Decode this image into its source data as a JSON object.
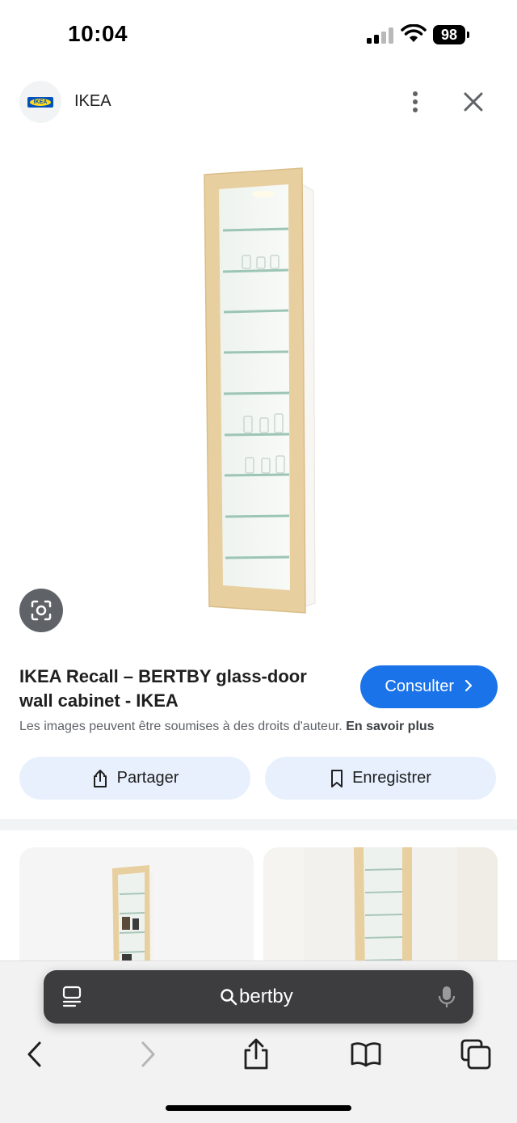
{
  "status": {
    "time": "10:04",
    "battery": "98"
  },
  "header": {
    "site_name": "IKEA",
    "logo_text": "IKEA"
  },
  "result": {
    "title": "IKEA Recall – BERTBY glass-door wall cabinet - IKEA",
    "visit_label": "Consulter",
    "copyright_text": "Les images peuvent être soumises à des droits d'auteur.",
    "learn_more": "En savoir plus",
    "share_label": "Partager",
    "save_label": "Enregistrer"
  },
  "browser": {
    "address_text": "bertby"
  },
  "colors": {
    "accent": "#1a73e8",
    "pill_bg": "#e8f0fe",
    "cabinet_wood": "#e8cfa0"
  },
  "icons": [
    "lens-icon",
    "more-vert-icon",
    "close-icon",
    "share-icon",
    "bookmark-icon",
    "tabs-icon",
    "search-icon",
    "mic-icon",
    "back-icon",
    "forward-icon",
    "bookmarks-icon",
    "tab-overview-icon"
  ]
}
